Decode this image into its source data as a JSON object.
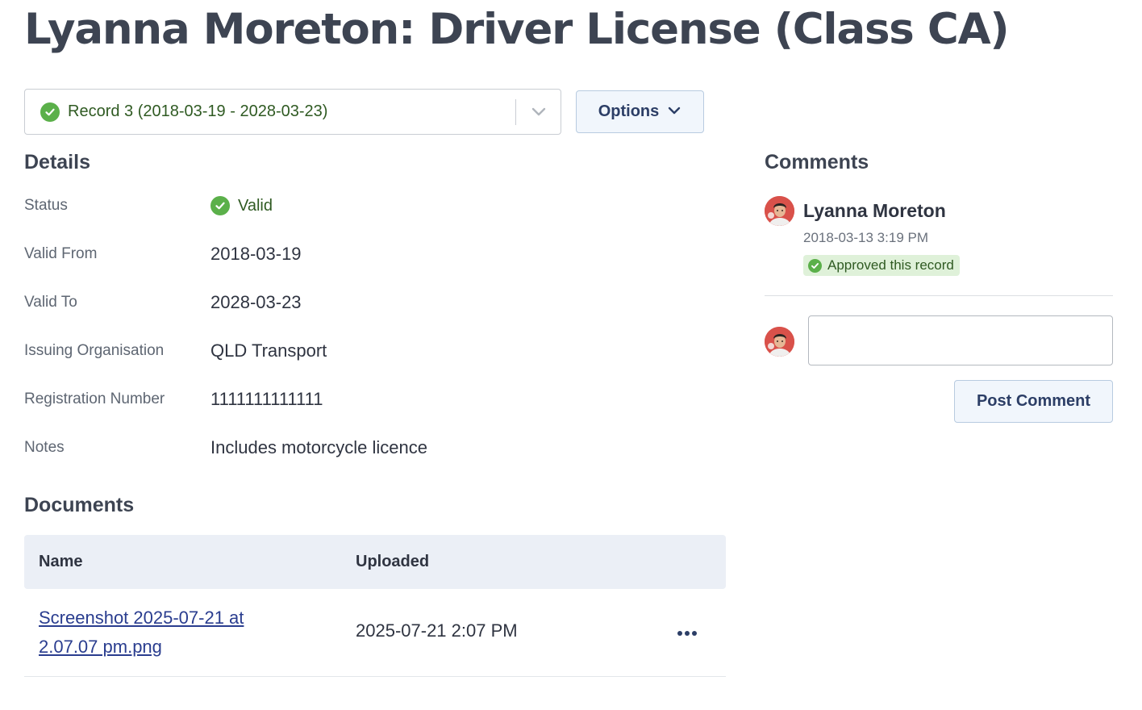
{
  "page": {
    "title": "Lyanna Moreton: Driver License (Class CA)"
  },
  "record_select": {
    "selected": "Record 3 (2018-03-19 - 2028-03-23)",
    "icon": "check-circle-icon"
  },
  "options": {
    "label": "Options"
  },
  "details": {
    "title": "Details",
    "rows": [
      {
        "label": "Status",
        "value": "Valid"
      },
      {
        "label": "Valid From",
        "value": "2018-03-19"
      },
      {
        "label": "Valid To",
        "value": "2028-03-23"
      },
      {
        "label": "Issuing Organisation",
        "value": "QLD Transport"
      },
      {
        "label": "Registration Number",
        "value": "1111111111111"
      },
      {
        "label": "Notes",
        "value": "Includes motorcycle licence"
      }
    ]
  },
  "documents": {
    "title": "Documents",
    "columns": [
      "Name",
      "Uploaded"
    ],
    "rows": [
      {
        "name": "Screenshot 2025-07-21 at 2.07.07 pm.png",
        "uploaded": "2025-07-21 2:07 PM"
      }
    ]
  },
  "comments": {
    "title": "Comments",
    "items": [
      {
        "author": "Lyanna Moreton",
        "time": "2018-03-13 3:19 PM",
        "badge": "Approved this record"
      }
    ],
    "input_value": "",
    "post_label": "Post Comment"
  },
  "colors": {
    "valid_green": "#5bb04a",
    "accent_navy": "#2c3e66",
    "link": "#2a3d8f"
  }
}
